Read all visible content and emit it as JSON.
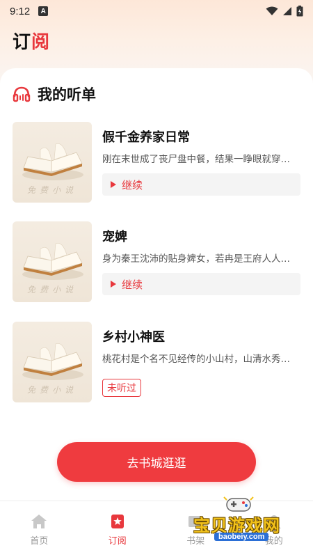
{
  "status_bar": {
    "time": "9:12",
    "notification_letter": "A"
  },
  "page": {
    "title_part1": "订",
    "title_part2": "阅"
  },
  "section": {
    "title": "我的听单"
  },
  "books": [
    {
      "title": "假千金养家日常",
      "desc": "刚在末世成了丧尸盘中餐，结果一睁眼就穿…",
      "action": "继续",
      "cover_text": "免费小说"
    },
    {
      "title": "宠婢",
      "desc": "身为秦王沈沛的贴身婢女，若冉是王府人人…",
      "action": "继续",
      "cover_text": "免费小说"
    },
    {
      "title": "乡村小神医",
      "desc": "桃花村是个名不见经传的小山村，山清水秀…",
      "status": "未听过",
      "cover_text": "免费小说"
    }
  ],
  "cta": {
    "label": "去书城逛逛"
  },
  "tabbar": {
    "items": [
      {
        "label": "首页",
        "icon": "home-icon"
      },
      {
        "label": "订阅",
        "icon": "bookmark-star-icon",
        "active": true
      },
      {
        "label": "书架",
        "icon": "bookshelf-icon"
      },
      {
        "label": "我的",
        "icon": "user-icon"
      }
    ]
  },
  "watermark": {
    "text": "宝贝游戏网",
    "url": "baobeiy.com"
  },
  "colors": {
    "accent": "#e8383d",
    "cta": "#ef3b3f"
  }
}
